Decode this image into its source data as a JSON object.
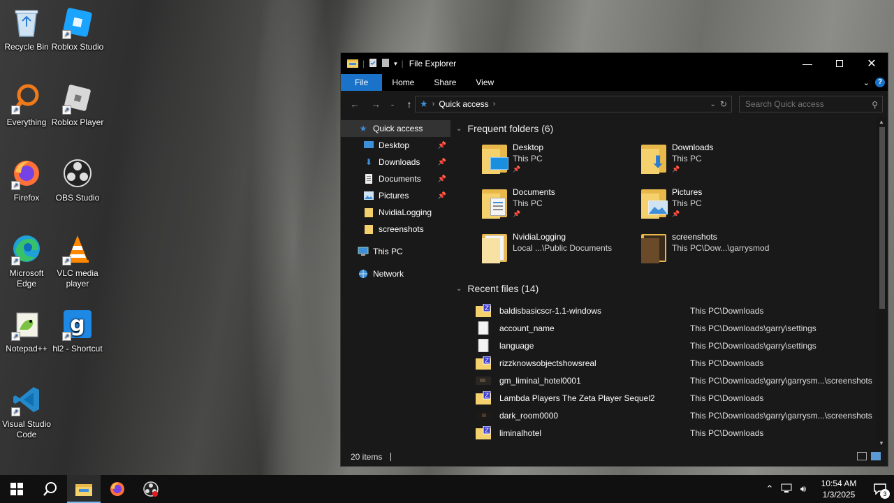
{
  "desktop": {
    "icons": [
      {
        "label": "Recycle Bin",
        "icon": "recycle-bin-icon"
      },
      {
        "label": "Roblox Studio",
        "icon": "roblox-studio-icon"
      },
      {
        "label": "Everything",
        "icon": "everything-search-icon"
      },
      {
        "label": "Roblox Player",
        "icon": "roblox-player-icon"
      },
      {
        "label": "Firefox",
        "icon": "firefox-icon"
      },
      {
        "label": "OBS Studio",
        "icon": "obs-studio-icon"
      },
      {
        "label": "Microsoft Edge",
        "icon": "edge-icon"
      },
      {
        "label": "VLC media player",
        "icon": "vlc-icon"
      },
      {
        "label": "Notepad++",
        "icon": "notepad-plus-plus-icon"
      },
      {
        "label": "hl2 - Shortcut",
        "icon": "garrys-mod-icon"
      },
      {
        "label": "Visual Studio Code",
        "icon": "vscode-icon"
      }
    ]
  },
  "window": {
    "title": "File Explorer",
    "ribbon_tabs": [
      "File",
      "Home",
      "Share",
      "View"
    ],
    "address": {
      "crumb": "Quick access"
    },
    "search": {
      "placeholder": "Search Quick access"
    },
    "nav": {
      "quick_access": "Quick access",
      "pinned": [
        "Desktop",
        "Downloads",
        "Documents",
        "Pictures"
      ],
      "recent_folders": [
        "NvidiaLogging",
        "screenshots"
      ],
      "this_pc": "This PC",
      "network": "Network"
    },
    "frequent": {
      "header": "Frequent folders (6)",
      "items": [
        {
          "name": "Desktop",
          "location": "This PC",
          "pinned": true
        },
        {
          "name": "Downloads",
          "location": "This PC",
          "pinned": true
        },
        {
          "name": "Documents",
          "location": "This PC",
          "pinned": true
        },
        {
          "name": "Pictures",
          "location": "This PC",
          "pinned": true
        },
        {
          "name": "NvidiaLogging",
          "location": "Local ...\\Public Documents",
          "pinned": false
        },
        {
          "name": "screenshots",
          "location": "This PC\\Dow...\\garrysmod",
          "pinned": false
        }
      ]
    },
    "recent": {
      "header": "Recent files (14)",
      "items": [
        {
          "name": "baldisbasicscr-1.1-windows",
          "path": "This PC\\Downloads",
          "kind": "zip"
        },
        {
          "name": "account_name",
          "path": "This PC\\Downloads\\garry\\settings",
          "kind": "file"
        },
        {
          "name": "language",
          "path": "This PC\\Downloads\\garry\\settings",
          "kind": "file"
        },
        {
          "name": "rizzknowsobjectshowsreal",
          "path": "This PC\\Downloads",
          "kind": "zip"
        },
        {
          "name": "gm_liminal_hotel0001",
          "path": "This PC\\Downloads\\garry\\garrysm...\\screenshots",
          "kind": "image"
        },
        {
          "name": "Lambda Players The Zeta Player Sequel2",
          "path": "This PC\\Downloads",
          "kind": "zip"
        },
        {
          "name": "dark_room0000",
          "path": "This PC\\Downloads\\garry\\garrysm...\\screenshots",
          "kind": "image"
        },
        {
          "name": "liminalhotel",
          "path": "This PC\\Downloads",
          "kind": "zip"
        }
      ]
    },
    "status": {
      "count": "20 items"
    }
  },
  "taskbar": {
    "time": "10:54 AM",
    "date": "1/3/2025",
    "notifications": "3"
  },
  "colors": {
    "accent": "#1a73c8",
    "folder": "#f5d16e",
    "dark_bg": "#191919"
  }
}
